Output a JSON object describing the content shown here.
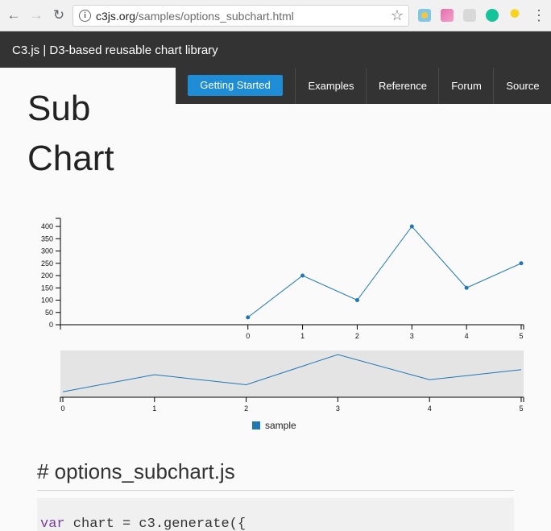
{
  "browser": {
    "url_host": "c3js.org",
    "url_path": "/samples/options_subchart.html"
  },
  "header": {
    "site_title": "C3.js | D3-based reusable chart library"
  },
  "nav": {
    "items": [
      "Getting Started",
      "Examples",
      "Reference",
      "Forum",
      "Source"
    ]
  },
  "page": {
    "title_line1": "Sub",
    "title_line2": "Chart",
    "code_heading": "# options_subchart.js",
    "code_keyword": "var",
    "code_rest": " chart = c3.generate({"
  },
  "colors": {
    "series": "#1f77b4",
    "accent": "#1f8dd6",
    "navbar": "#333333"
  },
  "chart_data": {
    "type": "line",
    "x": [
      0,
      1,
      2,
      3,
      4,
      5
    ],
    "series": [
      {
        "name": "sample",
        "values": [
          30,
          200,
          100,
          400,
          150,
          250
        ]
      }
    ],
    "ylim": [
      0,
      400
    ],
    "y_ticks": [
      0,
      50,
      100,
      150,
      200,
      250,
      300,
      350,
      400
    ],
    "x_ticks": [
      0,
      1,
      2,
      3,
      4,
      5
    ],
    "main_view_xlim": [
      -3.43,
      5
    ],
    "subchart": true,
    "legend": "bottom"
  }
}
